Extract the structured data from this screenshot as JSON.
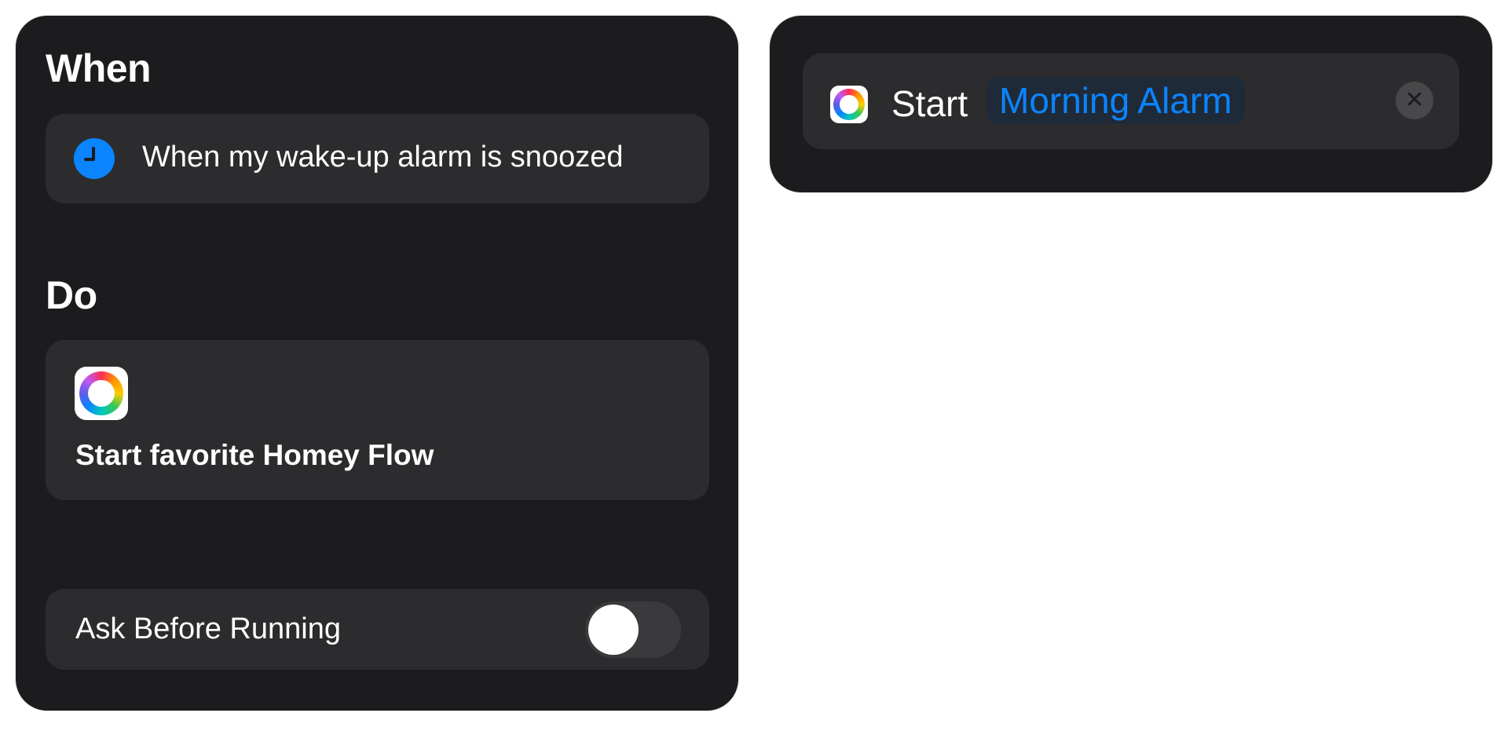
{
  "when": {
    "title": "When",
    "trigger": {
      "icon": "clock-icon",
      "text": "When my wake-up alarm is snoozed"
    }
  },
  "do": {
    "title": "Do",
    "action": {
      "icon": "homey-app-icon",
      "title": "Start favorite Homey Flow"
    }
  },
  "settings": {
    "ask_before_running_label": "Ask Before Running",
    "ask_before_running": false
  },
  "detail": {
    "icon": "homey-app-icon",
    "verb": "Start",
    "flow_name": "Morning Alarm",
    "clear_icon": "close-icon",
    "clear_glyph": "✕"
  },
  "colors": {
    "accent": "#0a84ff",
    "panel": "#1c1c1e",
    "card": "#2c2c2e",
    "toggle_off": "#3a3a3c"
  }
}
